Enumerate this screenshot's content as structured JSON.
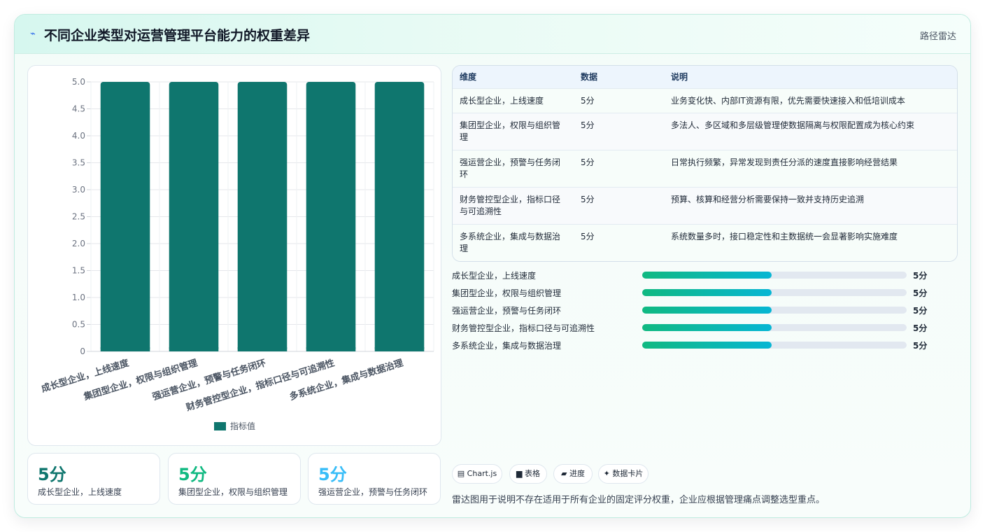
{
  "header": {
    "icon": "pulse-icon",
    "title": "不同企业类型对运营管理平台能力的权重差异",
    "right_label": "路径雷达"
  },
  "colors": {
    "bar": "#0f766e",
    "accent_green": "#10b981",
    "accent_cyan": "#06b6d4",
    "stat1": "#0f766e",
    "stat2": "#10b981",
    "stat3": "#38bdf8"
  },
  "chart_data": {
    "type": "bar",
    "categories": [
      "成长型企业，上线速度",
      "集团型企业，权限与组织管理",
      "强运营企业，预警与任务闭环",
      "财务管控型企业，指标口径与可追溯性",
      "多系统企业，集成与数据治理"
    ],
    "series": [
      {
        "name": "指标值",
        "values": [
          5,
          5,
          5,
          5,
          5
        ]
      }
    ],
    "ylim": [
      0,
      5
    ],
    "yticks": [
      "0",
      "0.5",
      "1.0",
      "1.5",
      "2.0",
      "2.5",
      "3.0",
      "3.5",
      "4.0",
      "4.5",
      "5.0"
    ],
    "grid": true,
    "legend": "bottom"
  },
  "table": {
    "headers": [
      "维度",
      "数据",
      "说明"
    ],
    "rows": [
      {
        "dim": "成长型企业，上线速度",
        "val": "5分",
        "desc": "业务变化快、内部IT资源有限，优先需要快速接入和低培训成本"
      },
      {
        "dim": "集团型企业，权限与组织管理",
        "val": "5分",
        "desc": "多法人、多区域和多层级管理使数据隔离与权限配置成为核心约束"
      },
      {
        "dim": "强运营企业，预警与任务闭环",
        "val": "5分",
        "desc": "日常执行频繁，异常发现到责任分派的速度直接影响经营结果"
      },
      {
        "dim": "财务管控型企业，指标口径与可追溯性",
        "val": "5分",
        "desc": "预算、核算和经营分析需要保持一致并支持历史追溯"
      },
      {
        "dim": "多系统企业，集成与数据治理",
        "val": "5分",
        "desc": "系统数量多时，接口稳定性和主数据统一会显著影响实施难度"
      }
    ]
  },
  "progress": [
    {
      "label": "成长型企业，上线速度",
      "value": "5分",
      "fraction": 0.49
    },
    {
      "label": "集团型企业，权限与组织管理",
      "value": "5分",
      "fraction": 0.49
    },
    {
      "label": "强运营企业，预警与任务闭环",
      "value": "5分",
      "fraction": 0.49
    },
    {
      "label": "财务管控型企业，指标口径与可追溯性",
      "value": "5分",
      "fraction": 0.49
    },
    {
      "label": "多系统企业，集成与数据治理",
      "value": "5分",
      "fraction": 0.49
    }
  ],
  "stats": [
    {
      "value": "5分",
      "label": "成长型企业，上线速度"
    },
    {
      "value": "5分",
      "label": "集团型企业，权限与组织管理"
    },
    {
      "value": "5分",
      "label": "强运营企业，预警与任务闭环"
    }
  ],
  "tags": [
    {
      "icon": "chart-icon",
      "label": "▤ Chart.js"
    },
    {
      "icon": "table-icon",
      "label": "▆ 表格"
    },
    {
      "icon": "progress-icon",
      "label": "▰ 进度"
    },
    {
      "icon": "sparkle-icon",
      "label": "✦ 数据卡片"
    }
  ],
  "note": "雷达图用于说明不存在适用于所有企业的固定评分权重，企业应根据管理痛点调整选型重点。"
}
